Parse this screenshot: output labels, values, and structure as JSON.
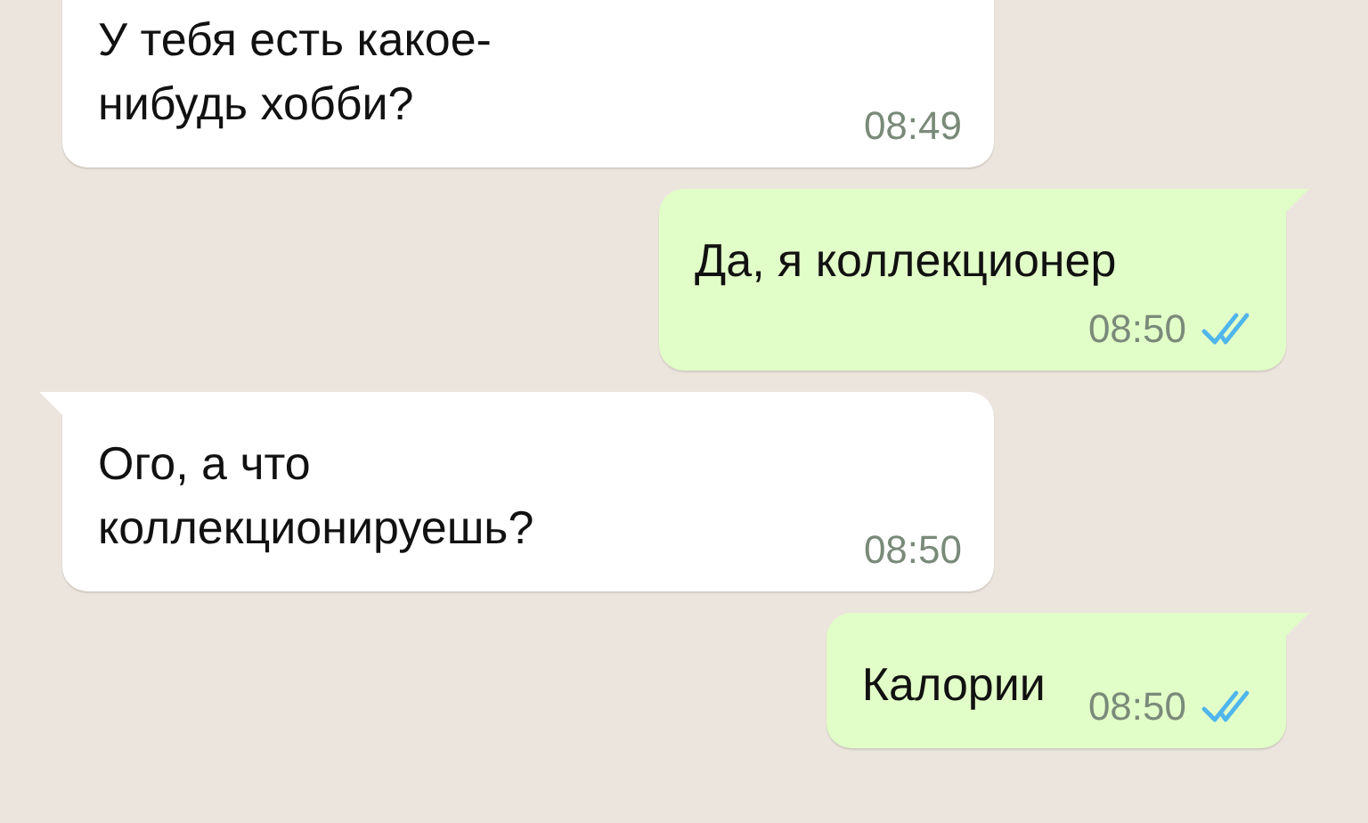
{
  "messages": [
    {
      "kind": "incoming",
      "text": "У тебя есть какое-нибудь хобби?",
      "time": "08:49"
    },
    {
      "kind": "outgoing",
      "text": "Да, я коллекционер",
      "time": "08:50",
      "read": true
    },
    {
      "kind": "incoming",
      "text": "Ого, а что коллекционируешь?",
      "time": "08:50"
    },
    {
      "kind": "outgoing",
      "text": "Калории",
      "time": "08:50",
      "read": true
    }
  ]
}
